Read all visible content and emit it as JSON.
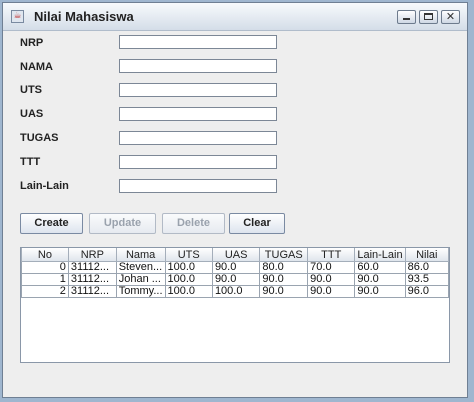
{
  "window": {
    "title": "Nilai Mahasiswa"
  },
  "form": {
    "fields": [
      {
        "label": "NRP",
        "value": ""
      },
      {
        "label": "NAMA",
        "value": ""
      },
      {
        "label": "UTS",
        "value": ""
      },
      {
        "label": "UAS",
        "value": ""
      },
      {
        "label": "TUGAS",
        "value": ""
      },
      {
        "label": "TTT",
        "value": ""
      },
      {
        "label": "Lain-Lain",
        "value": ""
      }
    ]
  },
  "buttons": {
    "create": "Create",
    "update": "Update",
    "delete": "Delete",
    "clear": "Clear"
  },
  "table": {
    "columns": [
      "No",
      "NRP",
      "Nama",
      "UTS",
      "UAS",
      "TUGAS",
      "TTT",
      "Lain-Lain",
      "Nilai"
    ],
    "rows": [
      [
        "0",
        "31112...",
        "Steven...",
        "100.0",
        "90.0",
        "80.0",
        "70.0",
        "60.0",
        "86.0"
      ],
      [
        "1",
        "31112...",
        "Johan ...",
        "100.0",
        "90.0",
        "90.0",
        "90.0",
        "90.0",
        "93.5"
      ],
      [
        "2",
        "31112...",
        "Tommy...",
        "100.0",
        "100.0",
        "90.0",
        "90.0",
        "90.0",
        "96.0"
      ]
    ]
  }
}
